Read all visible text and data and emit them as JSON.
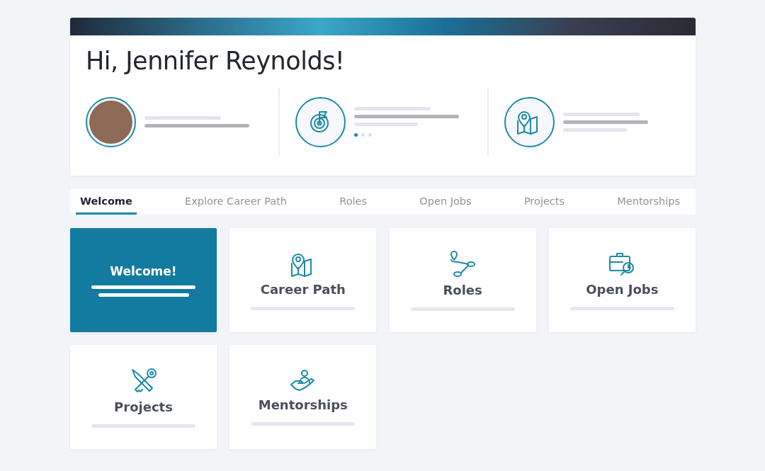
{
  "greeting": "Hi, Jennifer Reynolds!",
  "goal_dots": [
    {
      "selected": true
    },
    {
      "selected": false
    },
    {
      "selected": false
    }
  ],
  "tabs": [
    {
      "label": "Welcome",
      "selected": true
    },
    {
      "label": "Explore Career Path",
      "selected": false
    },
    {
      "label": "Roles",
      "selected": false
    },
    {
      "label": "Open Jobs",
      "selected": false
    },
    {
      "label": "Projects",
      "selected": false
    },
    {
      "label": "Mentorships",
      "selected": false
    }
  ],
  "tiles": [
    {
      "kind": "welcome",
      "label": "Welcome!"
    },
    {
      "kind": "feature",
      "label": "Career Path"
    },
    {
      "kind": "feature",
      "label": "Roles"
    },
    {
      "kind": "feature",
      "label": "Open Jobs"
    },
    {
      "kind": "feature",
      "label": "Projects"
    },
    {
      "kind": "feature",
      "label": "Mentorships"
    }
  ]
}
